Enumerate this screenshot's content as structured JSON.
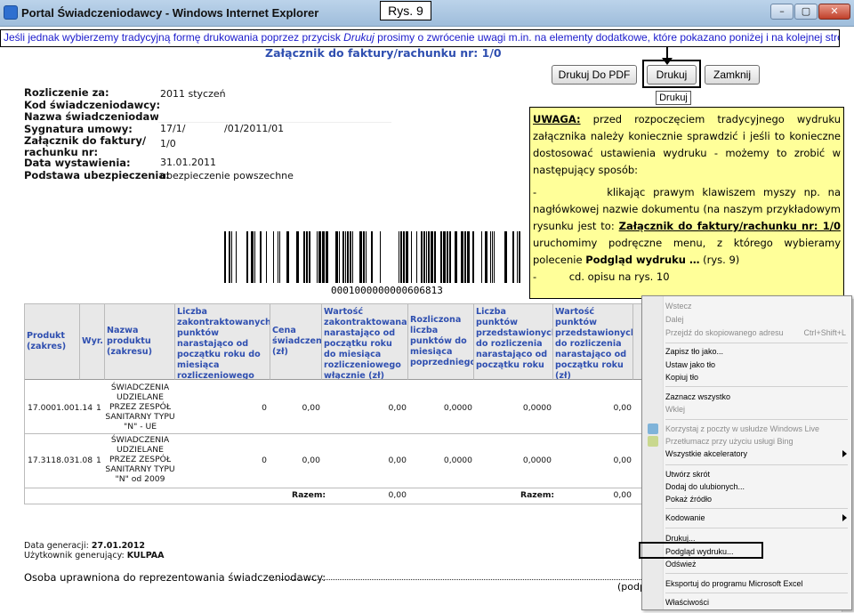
{
  "window": {
    "title": "Portal Świadczeniodawcy - Windows Internet Explorer",
    "minimize_glyph": "–",
    "maximize_glyph": "▢",
    "close_glyph": "✕",
    "icon": "ie-icon"
  },
  "figure_label": "Rys. 9",
  "instruction": {
    "part1": "Jeśli jednak wybierzemy tradycyjną formę drukowania poprzez przycisk ",
    "highlight": "Drukuj",
    "part2": " prosimy o zwrócenie uwagi m.in. na elementy dodatkowe, które pokazano poniżej i na kolejnej stronie."
  },
  "document": {
    "title": "Załącznik do faktury/rachunku nr: 1/0",
    "toolbar": {
      "print_pdf": "Drukuj Do PDF",
      "print": "Drukuj",
      "close": "Zamknij",
      "tooltip": "Drukuj"
    },
    "fields": [
      {
        "label": "Rozliczenie za:",
        "value": "2011  styczeń"
      },
      {
        "label": "Kod świadczeniodawcy:",
        "value": ""
      },
      {
        "label": "Nazwa świadczeniodawcy:",
        "value": ""
      },
      {
        "label": "Sygnatura umowy:",
        "value": "17/1/",
        "value2": "/01/2011/01"
      },
      {
        "label": "Załącznik do faktury/",
        "value": "1/0"
      },
      {
        "label": "rachunku nr:",
        "value": ""
      },
      {
        "label": "Data wystawienia:",
        "value": "31.01.2011"
      },
      {
        "label": "Podstawa ubezpieczenia:",
        "value": "ubezpieczenie powszechne"
      }
    ],
    "barcode_number": "0001000000000606813",
    "table": {
      "headers": [
        "Produkt (zakres)",
        "Wyr.",
        "Nazwa produktu (zakresu)",
        "Liczba zakontraktowanych punktów narastająco od początku roku do miesiąca rozliczeniowego włącznie",
        "Cena świadczenia (zł)",
        "Wartość zakontraktowana narastająco od początku roku do miesiąca rozliczeniowego włącznie (zł)",
        "Rozliczona liczba punktów do miesiąca poprzedniego",
        "Liczba punktów przedstawionych do rozliczenia narastająco od początku roku",
        "Wartość punktów przedstawionych do rozliczenia narastająco od początku roku (zł)",
        ""
      ],
      "rows": [
        {
          "produkt": "17.0001.001.14",
          "wyr": "1",
          "nazwa": [
            "ŚWIADCZENIA",
            "UDZIELANE",
            "PRZEZ ZESPÓŁ",
            "SANITARNY TYPU",
            "\"N\" - UE"
          ],
          "liczba": "0",
          "cena": "0,00",
          "wartosc": "0,00",
          "rozliczona": "0,0000",
          "punkty": "0,0000",
          "wartosc_pkt": "0,00"
        },
        {
          "produkt": "17.3118.031.08",
          "wyr": "1",
          "nazwa": [
            "ŚWIADCZENIA",
            "UDZIELANE",
            "PRZEZ ZESPÓŁ",
            "SANITARNY TYPU",
            "\"N\" od 2009"
          ],
          "liczba": "0",
          "cena": "0,00",
          "wartosc": "0,00",
          "rozliczona": "0,0000",
          "punkty": "0,0000",
          "wartosc_pkt": "0,00"
        }
      ],
      "total_label": "Razem:",
      "total_values": [
        "0,00",
        "0,00"
      ]
    },
    "footer": {
      "date_label": "Data generacji:",
      "date_value": "27.01.2012",
      "user_label": "Użytkownik generujący:",
      "user_value": "KULPAA",
      "rep_label": "Osoba uprawniona do reprezentowania świadczeniodawcy:",
      "sign_label": "(podpis"
    }
  },
  "warning": {
    "heading": "UWAGA:",
    "text1": " przed rozpoczęciem tradycyjnego wydruku załącznika należy koniecznie sprawdzić i jeśli to konieczne dostosować ustawienia wydruku - możemy to zrobić w następujący sposób:",
    "bullet": "-",
    "text2a": "klikając prawym klawiszem myszy np. na nagłówkowej nazwie dokumentu (na naszym przykładowym rysunku jest to: ",
    "text2b": "Załącznik do faktury/rachunku nr: 1/0",
    "text2c": " uruchomimy podręczne menu, z którego wybieramy polecenie ",
    "text2d": "Podgląd wydruku …",
    "text2e": " (rys. 9)",
    "text3": "-          cd. opisu na rys. 10"
  },
  "context_menu": {
    "items": [
      {
        "label": "Wstecz",
        "disabled": true
      },
      {
        "label": "Dalej",
        "disabled": true
      },
      {
        "label": "Przejdź do skopiowanego adresu",
        "disabled": true,
        "shortcut": "Ctrl+Shift+L"
      },
      {
        "label": "Zapisz tło jako..."
      },
      {
        "label": "Ustaw jako tło"
      },
      {
        "label": "Kopiuj tło"
      },
      {
        "label": "Zaznacz wszystko"
      },
      {
        "label": "Wklej",
        "disabled": true
      },
      {
        "label": "Korzystaj z poczty w usłudze Windows Live",
        "disabled": true
      },
      {
        "label": "Przetłumacz przy użyciu usługi Bing",
        "disabled": true
      },
      {
        "label": "Wszystkie akceleratory"
      },
      {
        "label": "Utwórz skrót"
      },
      {
        "label": "Dodaj do ulubionych..."
      },
      {
        "label": "Pokaż źródło"
      },
      {
        "label": "Kodowanie"
      },
      {
        "label": "Drukuj..."
      },
      {
        "label": "Podgląd wydruku..."
      },
      {
        "label": "Odśwież"
      },
      {
        "label": "Eksportuj do programu Microsoft Excel"
      },
      {
        "label": "Właściwości"
      }
    ]
  },
  "colors": {
    "instruction_text": "#1a1acc",
    "doc_title": "#2f4fb0",
    "warning_bg": "#ffff99",
    "table_header_bg": "#e8e8e8"
  }
}
